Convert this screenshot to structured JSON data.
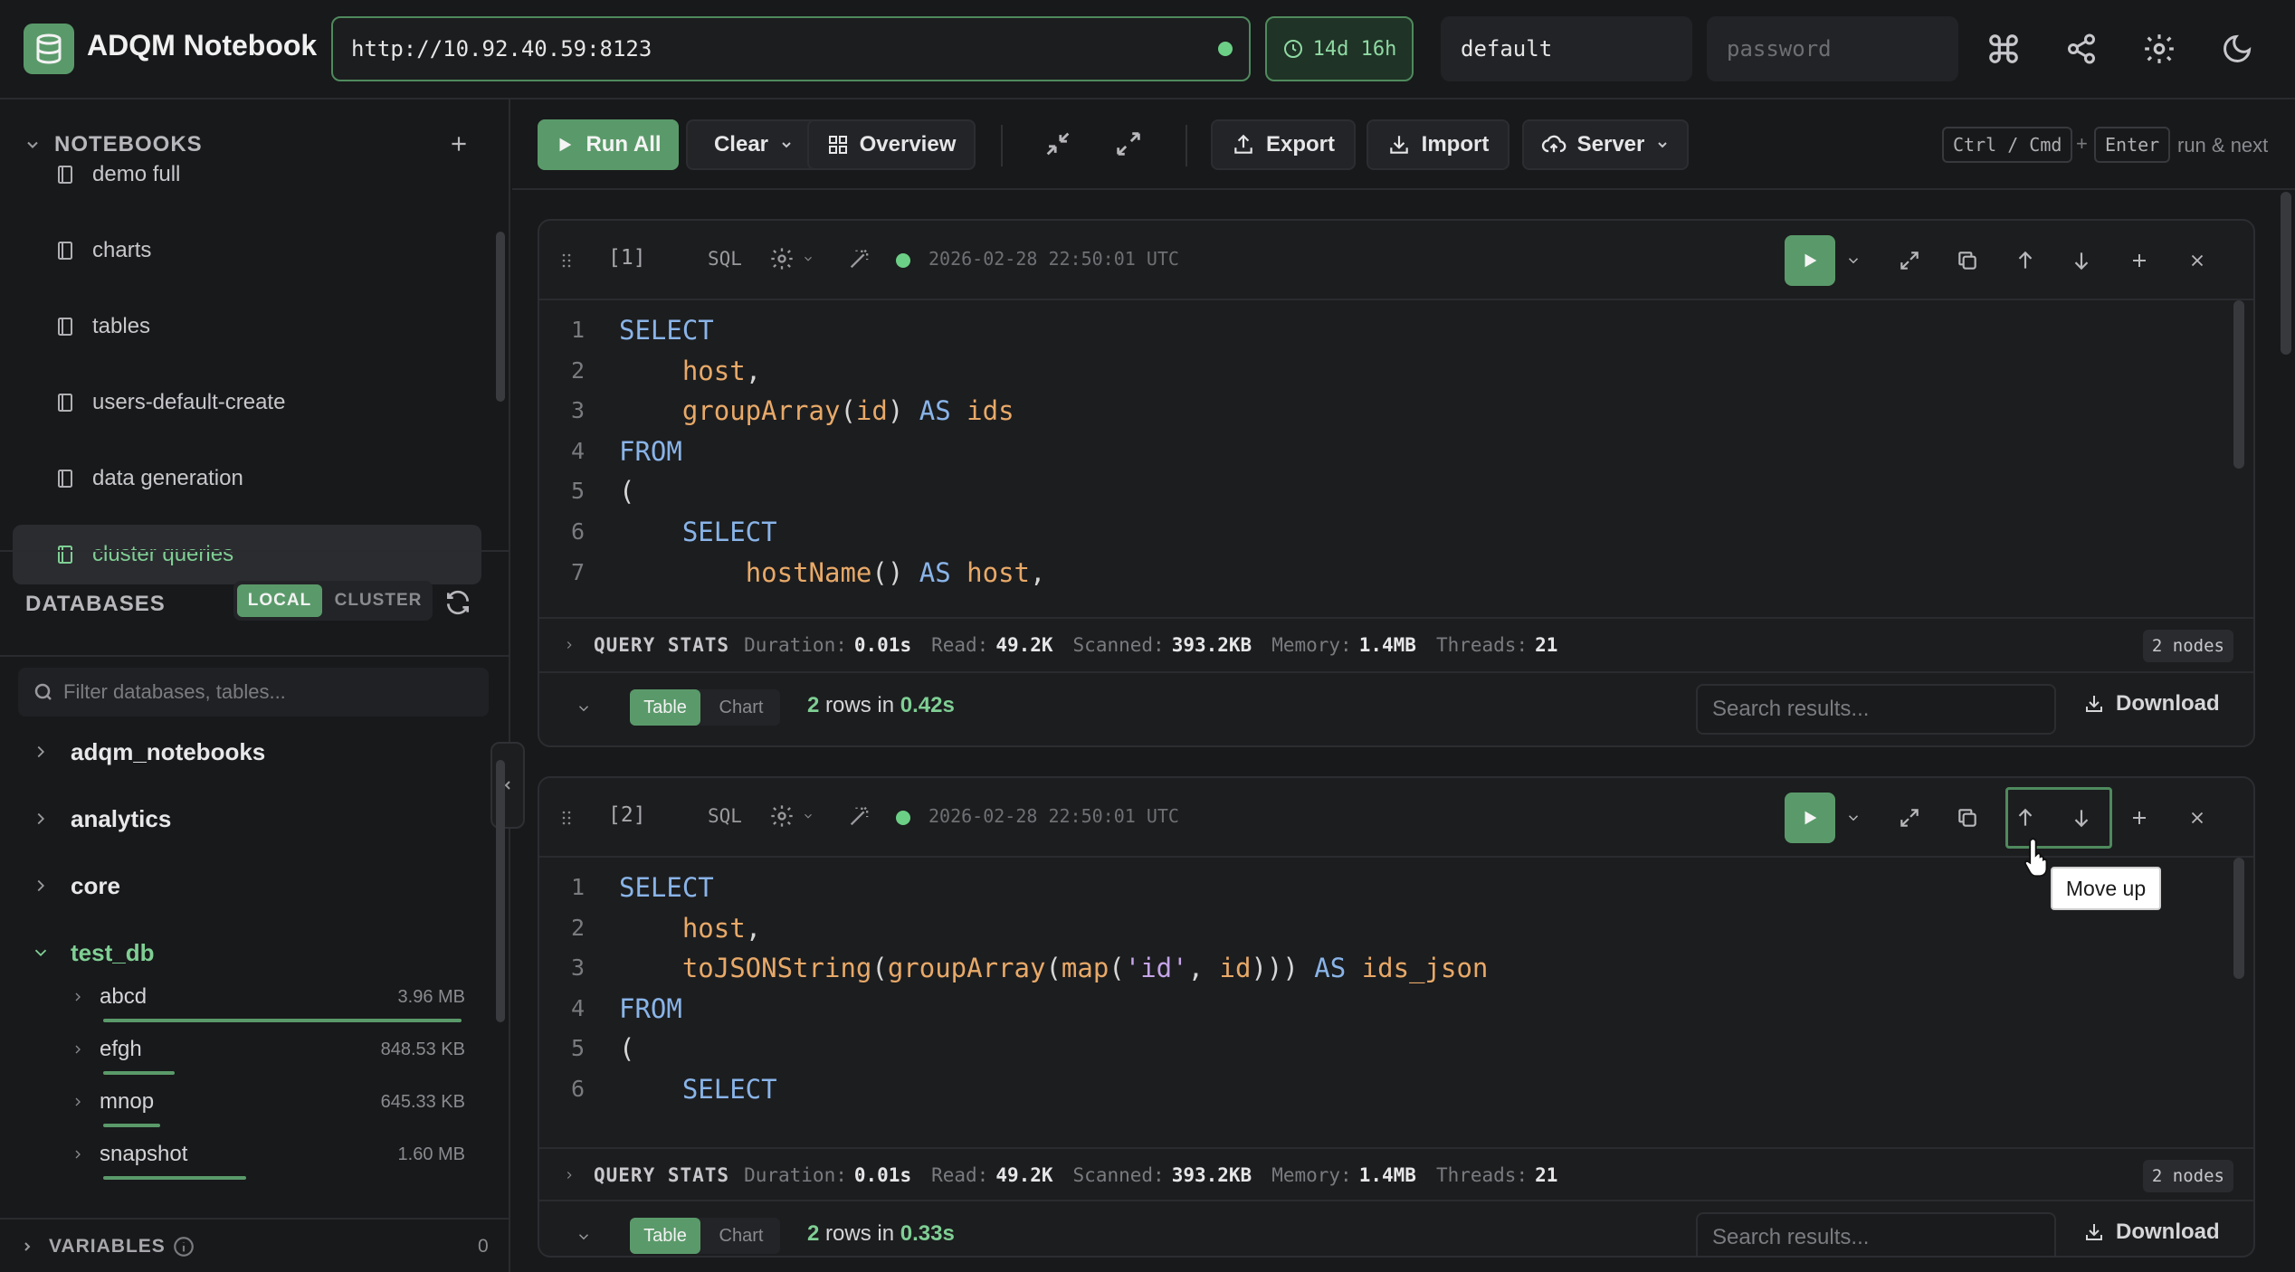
{
  "app": {
    "title": "ADQM Notebook"
  },
  "connection": {
    "url": "http://10.92.40.59:8123",
    "uptime": "14d 16h",
    "username": "default",
    "password_placeholder": "password"
  },
  "sidebar": {
    "notebooks_heading": "NOTEBOOKS",
    "notebooks": [
      {
        "label": "demo full"
      },
      {
        "label": "charts"
      },
      {
        "label": "tables"
      },
      {
        "label": "users-default-create"
      },
      {
        "label": "data generation"
      },
      {
        "label": "cluster queries",
        "active": true
      }
    ],
    "databases_heading": "DATABASES",
    "scope_local": "LOCAL",
    "scope_cluster": "CLUSTER",
    "filter_placeholder": "Filter databases, tables...",
    "databases": [
      {
        "name": "adqm_notebooks"
      },
      {
        "name": "analytics"
      },
      {
        "name": "core"
      },
      {
        "name": "test_db",
        "expanded": true
      }
    ],
    "tables": [
      {
        "name": "abcd",
        "size": "3.96 MB",
        "fill": 1.0
      },
      {
        "name": "efgh",
        "size": "848.53 KB",
        "fill": 0.2
      },
      {
        "name": "mnop",
        "size": "645.33 KB",
        "fill": 0.16
      },
      {
        "name": "snapshot",
        "size": "1.60 MB",
        "fill": 0.4
      }
    ],
    "variables_label": "VARIABLES",
    "variables_count": "0"
  },
  "toolbar": {
    "run_all": "Run All",
    "clear": "Clear",
    "overview": "Overview",
    "export": "Export",
    "import": "Import",
    "server": "Server",
    "hint_key1": "Ctrl / Cmd",
    "hint_plus": "+",
    "hint_key2": "Enter",
    "hint_text": "run & next"
  },
  "cells": [
    {
      "index": "[1]",
      "lang": "SQL",
      "timestamp": "2026-02-28 22:50:01 UTC",
      "stats": {
        "title": "QUERY STATS",
        "duration_label": "Duration:",
        "duration": "0.01s",
        "read_label": "Read:",
        "read": "49.2K",
        "scanned_label": "Scanned:",
        "scanned": "393.2KB",
        "memory_label": "Memory:",
        "memory": "1.4MB",
        "threads_label": "Threads:",
        "threads": "21",
        "nodes": "2 nodes"
      },
      "view_table": "Table",
      "view_chart": "Chart",
      "rows_count": "2",
      "rows_label": "rows in",
      "rows_time": "0.42s",
      "search_placeholder": "Search results...",
      "download": "Download"
    },
    {
      "index": "[2]",
      "lang": "SQL",
      "timestamp": "2026-02-28 22:50:01 UTC",
      "stats": {
        "title": "QUERY STATS",
        "duration_label": "Duration:",
        "duration": "0.01s",
        "read_label": "Read:",
        "read": "49.2K",
        "scanned_label": "Scanned:",
        "scanned": "393.2KB",
        "memory_label": "Memory:",
        "memory": "1.4MB",
        "threads_label": "Threads:",
        "threads": "21",
        "nodes": "2 nodes"
      },
      "view_table": "Table",
      "view_chart": "Chart",
      "rows_count": "2",
      "rows_label": "rows in",
      "rows_time": "0.33s",
      "search_placeholder": "Search results...",
      "download": "Download"
    }
  ],
  "code": {
    "cell1": [
      [
        [
          "k",
          "SELECT"
        ]
      ],
      [
        [
          "p",
          "    "
        ],
        [
          "id",
          "host"
        ],
        [
          "p",
          ","
        ]
      ],
      [
        [
          "p",
          "    "
        ],
        [
          "fn",
          "groupArray"
        ],
        [
          "p",
          "("
        ],
        [
          "id",
          "id"
        ],
        [
          "p",
          ") "
        ],
        [
          "k",
          "AS"
        ],
        [
          "p",
          " "
        ],
        [
          "id",
          "ids"
        ]
      ],
      [
        [
          "k",
          "FROM"
        ]
      ],
      [
        [
          "p",
          "("
        ]
      ],
      [
        [
          "p",
          "    "
        ],
        [
          "k",
          "SELECT"
        ]
      ],
      [
        [
          "p",
          "        "
        ],
        [
          "fn",
          "hostName"
        ],
        [
          "p",
          "() "
        ],
        [
          "k",
          "AS"
        ],
        [
          "p",
          " "
        ],
        [
          "id",
          "host"
        ],
        [
          "p",
          ","
        ]
      ]
    ],
    "cell2": [
      [
        [
          "k",
          "SELECT"
        ]
      ],
      [
        [
          "p",
          "    "
        ],
        [
          "id",
          "host"
        ],
        [
          "p",
          ","
        ]
      ],
      [
        [
          "p",
          "    "
        ],
        [
          "fn",
          "toJSONString"
        ],
        [
          "p",
          "("
        ],
        [
          "fn",
          "groupArray"
        ],
        [
          "p",
          "("
        ],
        [
          "fn",
          "map"
        ],
        [
          "p",
          "("
        ],
        [
          "st",
          "'id'"
        ],
        [
          "p",
          ", "
        ],
        [
          "id",
          "id"
        ],
        [
          "p",
          "))) "
        ],
        [
          "k",
          "AS"
        ],
        [
          "p",
          " "
        ],
        [
          "id",
          "ids_json"
        ]
      ],
      [
        [
          "k",
          "FROM"
        ]
      ],
      [
        [
          "p",
          "("
        ]
      ],
      [
        [
          "p",
          "    "
        ],
        [
          "k",
          "SELECT"
        ]
      ]
    ]
  },
  "tooltip": {
    "text": "Move up"
  },
  "icons": {
    "logo": "database-icon",
    "uptime": "clock-icon",
    "command": "command-icon",
    "share": "share-icon",
    "settings": "gear-icon",
    "theme": "moon-icon"
  },
  "colors": {
    "accent": "#5a9a6a",
    "accent_text": "#7fcf94",
    "background": "#18191b"
  }
}
